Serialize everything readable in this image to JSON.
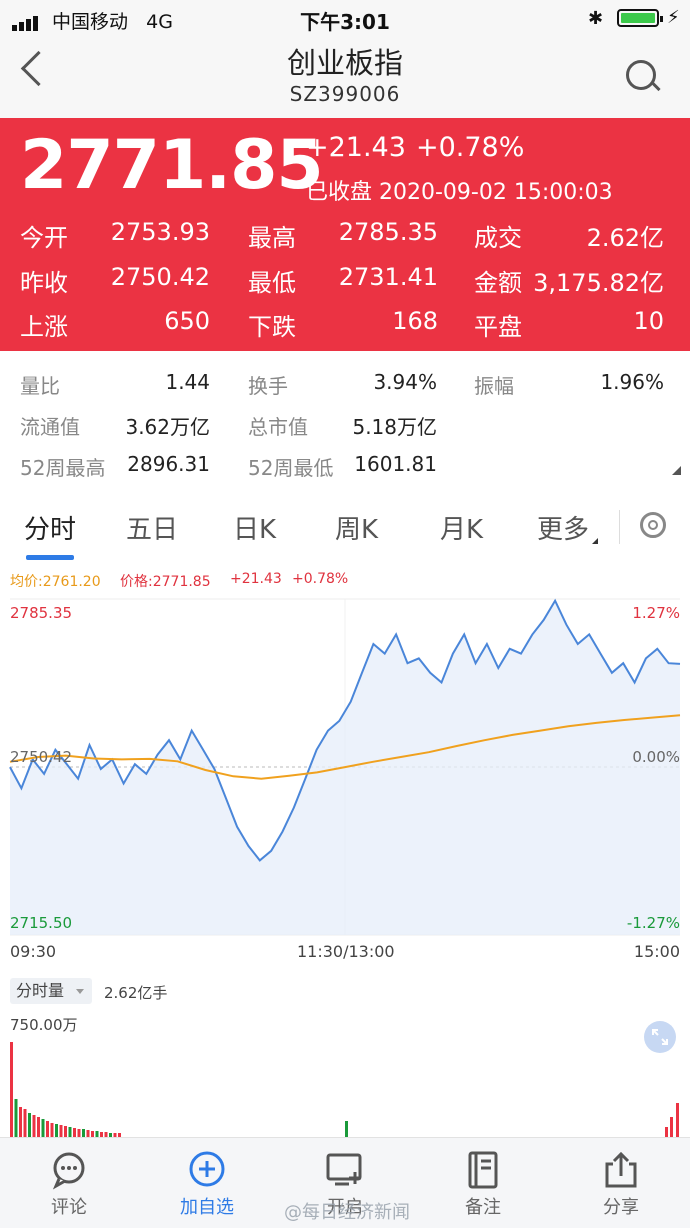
{
  "status_bar": {
    "carrier": "中国移动",
    "network": "4G",
    "time": "下午3:01"
  },
  "header": {
    "title": "创业板指",
    "code": "SZ399006"
  },
  "quote": {
    "price": "2771.85",
    "change": "+21.43",
    "change_pct": "+0.78%",
    "status_time": "已收盘 2020-09-02 15:00:03",
    "rows": [
      [
        {
          "label": "今开",
          "value": "2753.93"
        },
        {
          "label": "最高",
          "value": "2785.35"
        },
        {
          "label": "成交",
          "value": "2.62亿"
        }
      ],
      [
        {
          "label": "昨收",
          "value": "2750.42"
        },
        {
          "label": "最低",
          "value": "2731.41"
        },
        {
          "label": "金额",
          "value": "3,175.82亿"
        }
      ],
      [
        {
          "label": "上涨",
          "value": "650"
        },
        {
          "label": "下跌",
          "value": "168"
        },
        {
          "label": "平盘",
          "value": "10"
        }
      ]
    ]
  },
  "stats": [
    [
      {
        "label": "量比",
        "value": "1.44"
      },
      {
        "label": "换手",
        "value": "3.94%"
      },
      {
        "label": "振幅",
        "value": "1.96%"
      }
    ],
    [
      {
        "label": "流通值",
        "value": "3.62万亿"
      },
      {
        "label": "总市值",
        "value": "5.18万亿"
      }
    ],
    [
      {
        "label": "52周最高",
        "value": "2896.31"
      },
      {
        "label": "52周最低",
        "value": "1601.81"
      }
    ]
  ],
  "tabs": [
    "分时",
    "五日",
    "日K",
    "周K",
    "月K",
    "更多"
  ],
  "chart": {
    "legend": {
      "avg": "均价:2761.20",
      "price": "价格:2771.85",
      "chg": "+21.43",
      "pct": "+0.78%"
    },
    "y_top": "2785.35",
    "y_mid": "2750.42",
    "y_bot": "2715.50",
    "pct_top": "1.27%",
    "pct_mid": "0.00%",
    "pct_bot": "-1.27%",
    "x_start": "09:30",
    "x_mid": "11:30/13:00",
    "x_end": "15:00",
    "volume_btn": "分时量",
    "volume_total": "2.62亿手",
    "volume_max": "750.00万"
  },
  "colors": {
    "up": "#eb3343",
    "down": "#1a9a3a",
    "price_line": "#4a86d9",
    "avg_line": "#f0a11e",
    "accent": "#2e7be6"
  },
  "chart_data": {
    "type": "line",
    "x_range": [
      "09:30",
      "15:00"
    ],
    "ylim": [
      2715.5,
      2785.35
    ],
    "series": [
      {
        "values": [
          2750.4,
          2746,
          2752,
          2749,
          2754,
          2751,
          2748,
          2755,
          2750,
          2752,
          2747,
          2751,
          2749,
          2753,
          2756,
          2752,
          2758,
          2754,
          2750,
          2744,
          2738,
          2734,
          2731,
          2733,
          2737,
          2742,
          2748,
          2754,
          2758,
          2760,
          2764,
          2770,
          2776,
          2774,
          2778,
          2772,
          2773,
          2770,
          2768,
          2774,
          2778,
          2772,
          2776,
          2771,
          2775,
          2774,
          2778,
          2781,
          2785,
          2780,
          2776,
          2778,
          2774,
          2770,
          2772,
          2768,
          2773,
          2775,
          2772,
          2771.85
        ]
      },
      {
        "values": [
          2751.5,
          2752.5,
          2752.8,
          2752.2,
          2752.0,
          2752.1,
          2751.6,
          2749.8,
          2748.5,
          2748.0,
          2748.6,
          2749.3,
          2750.4,
          2751.5,
          2752.5,
          2753.5,
          2754.8,
          2756.0,
          2757.1,
          2758.0,
          2758.9,
          2759.6,
          2760.2,
          2760.7,
          2761.2
        ]
      }
    ]
  },
  "bottom_nav": [
    {
      "label": "评论",
      "icon": "comment-icon"
    },
    {
      "label": "加自选",
      "icon": "add-circle-icon"
    },
    {
      "label": "开启",
      "icon": "add-screen-icon"
    },
    {
      "label": "备注",
      "icon": "note-icon"
    },
    {
      "label": "分享",
      "icon": "share-icon"
    }
  ],
  "watermark": "@每日经济新闻"
}
